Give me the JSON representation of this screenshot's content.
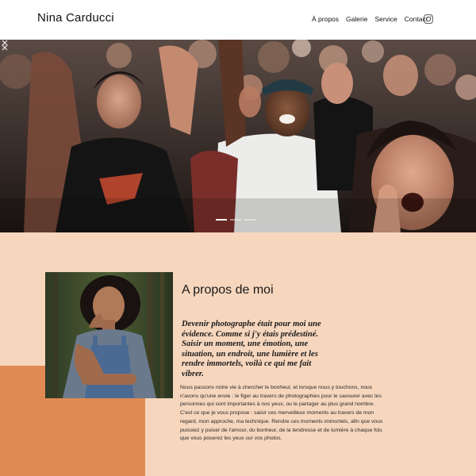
{
  "header": {
    "site_title": "Nina Carducci",
    "nav": [
      "À propos",
      "Galerie",
      "Service",
      "Contact"
    ],
    "social_icon": "instagram-icon"
  },
  "hero": {
    "image": "concert-crowd-photo",
    "slide_count": 3,
    "active_slide": 1,
    "prev_icon": "chevron-left-icon",
    "next_icon": "chevron-right-icon"
  },
  "about": {
    "image": "portrait-photo",
    "title": "A propos de moi",
    "quote": "Devenir photographe était pour moi une évidence. Comme si j'y étais prédestiné. Saisir un moment, une émotion, une situation, un endroit, une lumière et les rendre immortels, voilà ce qui me fait vibrer.",
    "body": "Nous passons notre vie à chercher le bonheur, et lorsque nous y touchons, nous n'avons qu'une envie : le figer au travers de photographies pour le savourer avec les personnes qui sont importantes à nos yeux, ou le partager au plus grand nombre. C'est ce que je vous propose : saisir ces merveilleux moments au travers de mon regard, mon approche, ma technique. Rendre ces moments immortels, afin que vous puissiez y puiser de l'amour, du bonheur, de la tendresse et de lumière à chaque fois que vous poserez les yeux sur vos photos."
  },
  "colors": {
    "section_bg": "#f6d6bd",
    "accent_block": "#e08a53",
    "header_bg": "#ffffff"
  }
}
